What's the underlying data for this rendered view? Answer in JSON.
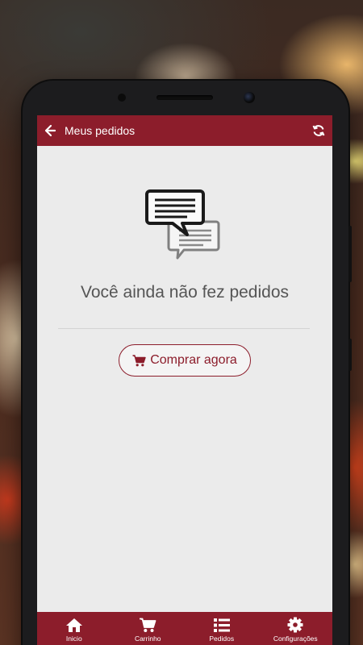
{
  "colors": {
    "brand": "#8c1d2b",
    "screen_bg": "#ebebeb",
    "text": "#555555"
  },
  "appbar": {
    "title": "Meus pedidos",
    "back_icon": "arrow-left-icon",
    "refresh_icon": "refresh-icon"
  },
  "empty_state": {
    "icon": "chat-bubbles-icon",
    "message": "Você ainda não fez pedidos"
  },
  "buy_button": {
    "icon": "cart-icon",
    "label": "Comprar agora"
  },
  "bottom_nav": {
    "items": [
      {
        "label": "Inicio",
        "icon": "home-icon"
      },
      {
        "label": "Carrinho",
        "icon": "cart-icon"
      },
      {
        "label": "Pedidos",
        "icon": "list-icon"
      },
      {
        "label": "Configurações",
        "icon": "gear-icon"
      }
    ]
  }
}
